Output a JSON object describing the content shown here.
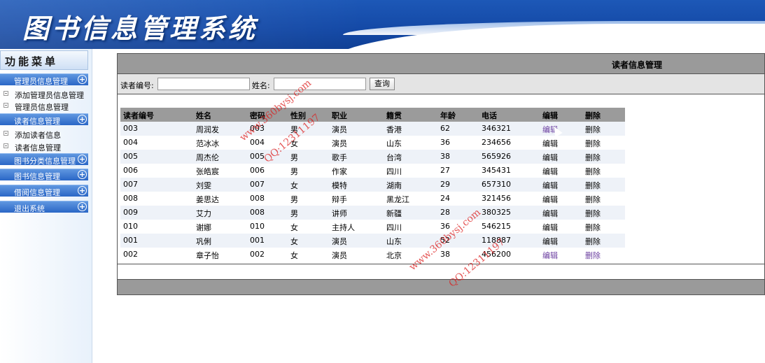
{
  "app": {
    "title": "图书信息管理系统"
  },
  "sidebar": {
    "menu_title": "功能菜单",
    "categories": [
      {
        "label": "管理员信息管理"
      },
      {
        "label": "读者信息管理"
      },
      {
        "label": "图书分类信息管理"
      },
      {
        "label": "图书信息管理"
      },
      {
        "label": "借阅信息管理"
      },
      {
        "label": "退出系统"
      }
    ],
    "subitems": [
      {
        "label": "添加管理员信息管理"
      },
      {
        "label": "管理员信息管理"
      },
      {
        "label": "添加读者信息"
      },
      {
        "label": "读者信息管理"
      }
    ],
    "plus_glyph": "+"
  },
  "main": {
    "title": "读者信息管理",
    "search": {
      "reader_id_label": "读者编号:",
      "reader_id_value": "",
      "name_label": "姓名:",
      "name_value": "",
      "query_button": "查询"
    },
    "table": {
      "headers": [
        "读者编号",
        "姓名",
        "密码",
        "性别",
        "职业",
        "籍贯",
        "年龄",
        "电话",
        "编辑",
        "删除"
      ],
      "rows": [
        [
          "003",
          "周润发",
          "003",
          "男",
          "演员",
          "香港",
          "62",
          "346321",
          "编辑",
          "删除"
        ],
        [
          "004",
          "范冰冰",
          "004",
          "女",
          "演员",
          "山东",
          "36",
          "234656",
          "编辑",
          "删除"
        ],
        [
          "005",
          "周杰伦",
          "005",
          "男",
          "歌手",
          "台湾",
          "38",
          "565926",
          "编辑",
          "删除"
        ],
        [
          "006",
          "张皓宸",
          "006",
          "男",
          "作家",
          "四川",
          "27",
          "345431",
          "编辑",
          "删除"
        ],
        [
          "007",
          "刘雯",
          "007",
          "女",
          "模特",
          "湖南",
          "29",
          "657310",
          "编辑",
          "删除"
        ],
        [
          "008",
          "姜思达",
          "008",
          "男",
          "辩手",
          "黑龙江",
          "24",
          "321456",
          "编辑",
          "删除"
        ],
        [
          "009",
          "艾力",
          "008",
          "男",
          "讲师",
          "新疆",
          "28",
          "380325",
          "编辑",
          "删除"
        ],
        [
          "010",
          "谢娜",
          "010",
          "女",
          "主持人",
          "四川",
          "36",
          "546215",
          "编辑",
          "删除"
        ],
        [
          "001",
          "巩俐",
          "001",
          "女",
          "演员",
          "山东",
          "52",
          "118887",
          "编辑",
          "删除"
        ],
        [
          "002",
          "章子怡",
          "002",
          "女",
          "演员",
          "北京",
          "38",
          "456200",
          "编辑",
          "删除"
        ]
      ]
    }
  },
  "watermarks": [
    "www.360bysj.com",
    "QQ:12311197",
    "www.360bysj.com",
    "QQ:12311197"
  ],
  "colors": {
    "banner": "#1449a6",
    "menu_category": "#2a66c6",
    "panel_bar": "#9a9a9a",
    "visited_link": "#6b3fa0",
    "watermark": "#dc1e1e"
  }
}
